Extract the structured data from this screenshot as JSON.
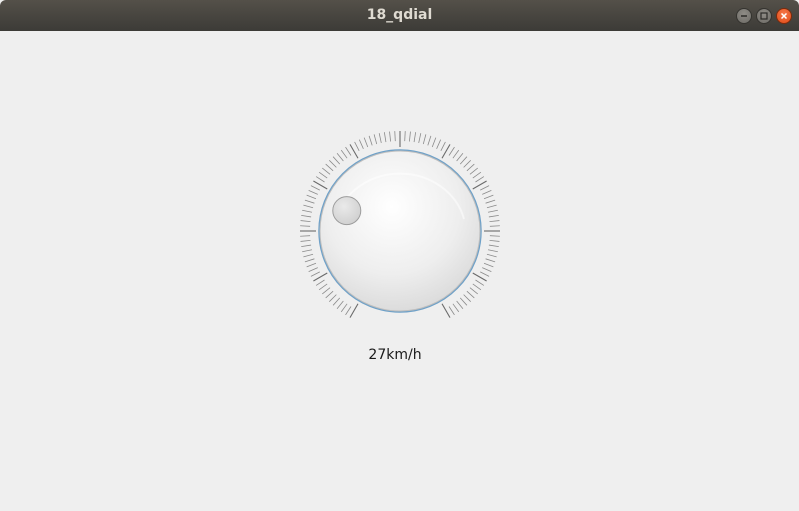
{
  "window": {
    "title": "18_qdial",
    "controls": [
      "minimize-icon",
      "maximize-icon",
      "close-icon"
    ]
  },
  "dial": {
    "value": 27,
    "minimum": 0,
    "maximum": 100,
    "notches_visible": true,
    "accent_color": "#6fa1c8"
  },
  "label": {
    "text": "27km/h"
  }
}
